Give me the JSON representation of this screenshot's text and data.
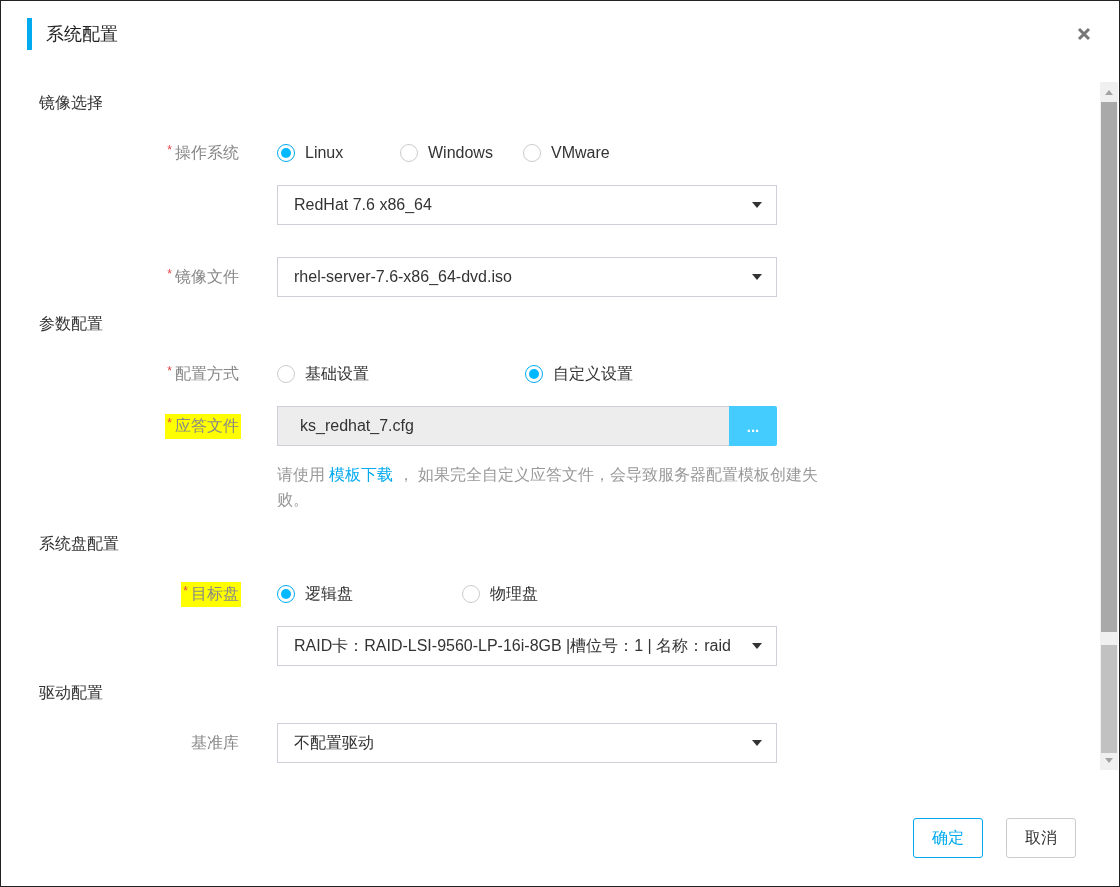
{
  "dialog": {
    "title": "系统配置"
  },
  "sections": [
    {
      "title": "镜像选择",
      "fields": [
        {
          "kind": "radio",
          "label": "操作系统",
          "mark": "*",
          "highlighted": false,
          "options": [
            {
              "label": "Linux",
              "selected": true
            },
            {
              "label": "Windows",
              "selected": false
            },
            {
              "label": "VMware",
              "selected": false
            }
          ]
        },
        {
          "kind": "select",
          "value": "RedHat 7.6 x86_64"
        },
        {
          "kind": "select",
          "label": "镜像文件",
          "mark": "*",
          "highlighted": false,
          "value": "rhel-server-7.6-x86_64-dvd.iso"
        }
      ]
    },
    {
      "title": "参数配置",
      "fields": [
        {
          "kind": "radio",
          "label": "配置方式",
          "mark": "*",
          "highlighted": false,
          "options": [
            {
              "label": "基础设置",
              "selected": false
            },
            {
              "label": "自定义设置",
              "selected": true
            }
          ]
        },
        {
          "kind": "file",
          "label": "应答文件",
          "mark": "*",
          "highlighted": true,
          "value": "ks_redhat_7.cfg",
          "button": "..."
        },
        {
          "kind": "hint",
          "before": "请使用 ",
          "link": "模板下载",
          "after": " ， 如果完全自定义应答文件，会导致服务器配置模板创建失败。"
        }
      ]
    },
    {
      "title": "系统盘配置",
      "fields": [
        {
          "kind": "radio",
          "label": "目标盘",
          "mark": "*",
          "highlighted": true,
          "options": [
            {
              "label": "逻辑盘",
              "selected": true
            },
            {
              "label": "物理盘",
              "selected": false
            }
          ]
        },
        {
          "kind": "select",
          "value": "RAID卡：RAID-LSI-9560-LP-16i-8GB |槽位号：1 | 名称：raid"
        }
      ]
    },
    {
      "title": "驱动配置",
      "fields": [
        {
          "kind": "select",
          "label": "基准库",
          "highlighted": false,
          "value": "不配置驱动"
        }
      ]
    }
  ],
  "buttons": [
    {
      "label": "确定",
      "primary": true
    },
    {
      "label": "取消",
      "primary": false
    }
  ]
}
